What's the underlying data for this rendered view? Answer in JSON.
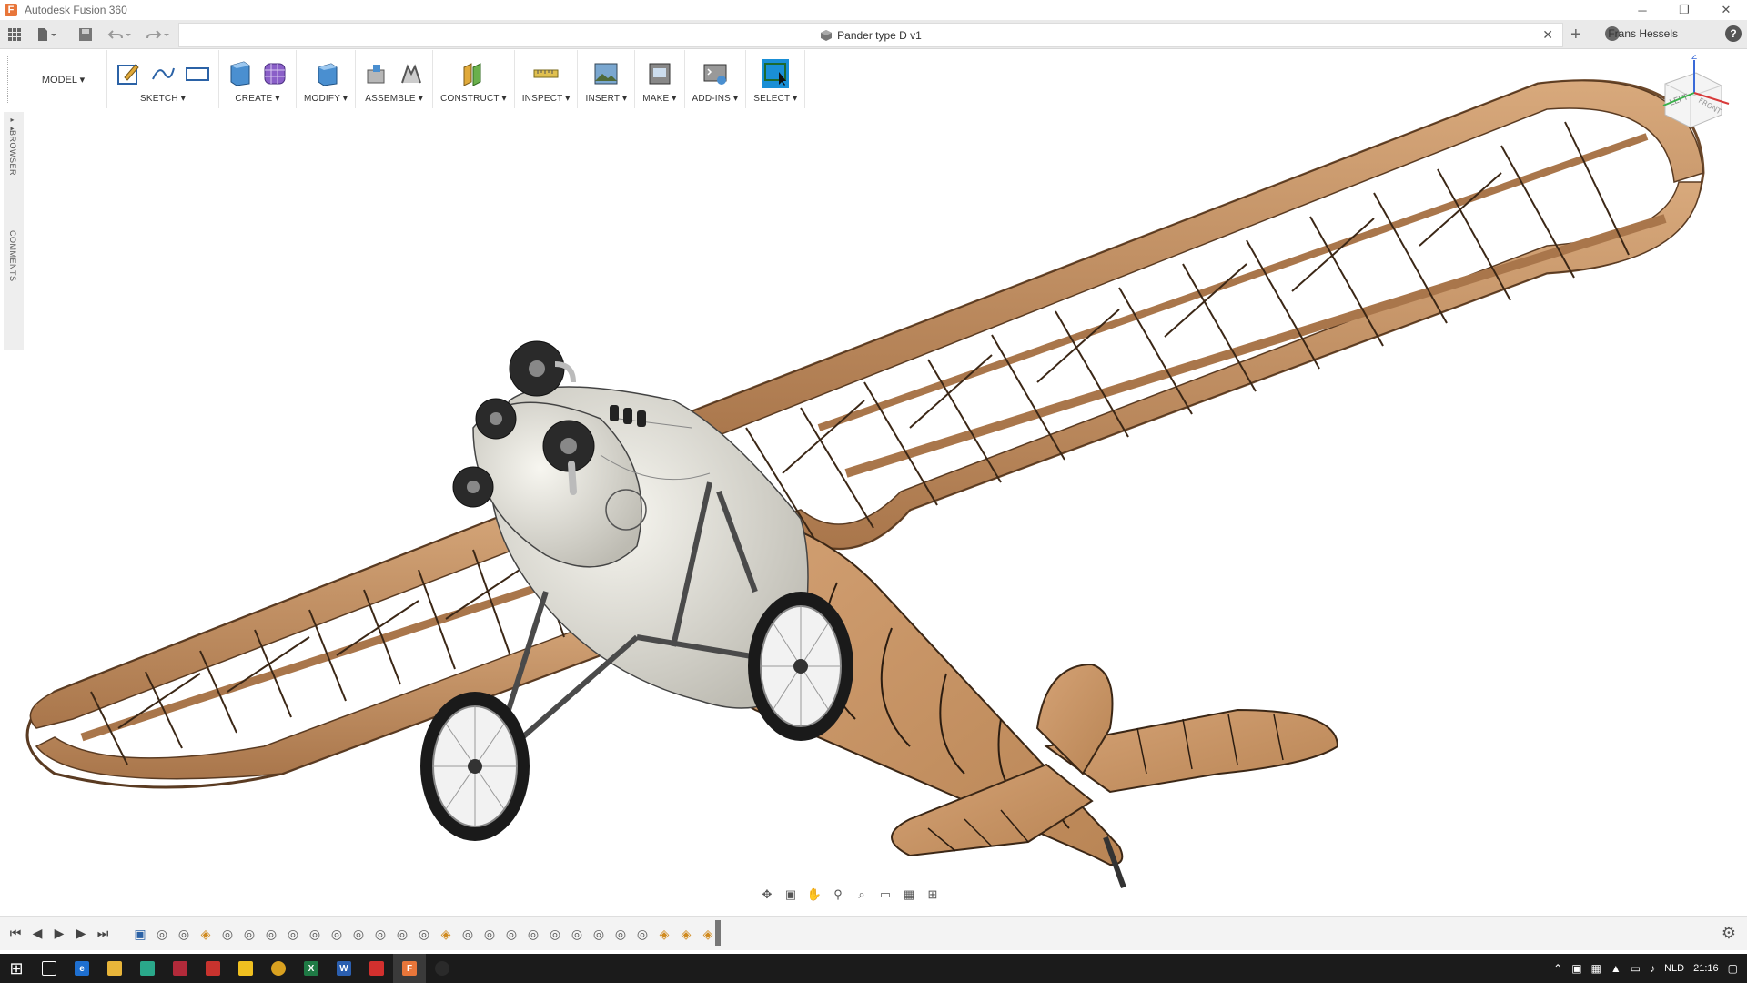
{
  "app": {
    "title": "Autodesk Fusion 360",
    "logo": "F"
  },
  "window_controls": {
    "minimize": "─",
    "restore": "❐",
    "close": "✕"
  },
  "tab": {
    "document_name": "Pander type D v1",
    "close": "✕",
    "add": "+"
  },
  "user": {
    "name": "Frans Hessels"
  },
  "toolbar": {
    "workspace": "MODEL ▾",
    "groups": [
      {
        "label": "SKETCH ▾"
      },
      {
        "label": "CREATE ▾"
      },
      {
        "label": "MODIFY ▾"
      },
      {
        "label": "ASSEMBLE ▾"
      },
      {
        "label": "CONSTRUCT ▾"
      },
      {
        "label": "INSPECT ▾"
      },
      {
        "label": "INSERT ▾"
      },
      {
        "label": "MAKE ▾"
      },
      {
        "label": "ADD-INS ▾"
      },
      {
        "label": "SELECT ▾"
      }
    ]
  },
  "side_panel": {
    "browser": "BROWSER",
    "comments": "COMMENTS",
    "expand": "▸▸"
  },
  "viewcube": {
    "left": "LEFT",
    "front": "FRONT",
    "z_axis": "Z"
  },
  "timeline": {
    "first": "⏮",
    "prev": "◀",
    "play": "▶",
    "next": "▶",
    "last": "⏭",
    "settings": "⚙"
  },
  "taskbar": {
    "start": "⊞",
    "language": "NLD",
    "time": "21:16"
  },
  "colors": {
    "wood": "#c9976a",
    "wood_dark": "#6e4a2c",
    "fuselage_white": "#ecebe4",
    "select_blue": "#1a8fd6",
    "taskbar": "#1b1b1b"
  }
}
